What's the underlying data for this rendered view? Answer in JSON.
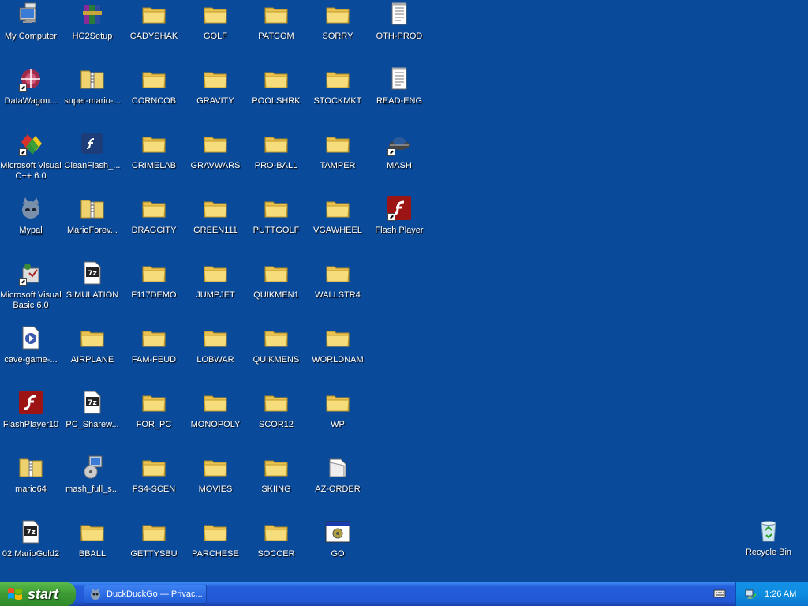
{
  "desktop": {
    "icons": [
      {
        "label": "My Computer",
        "type": "computer"
      },
      {
        "label": "DataWagon...",
        "type": "datawagon",
        "shortcut": true
      },
      {
        "label": "Microsoft Visual\nC++ 6.0",
        "type": "vcpp",
        "shortcut": true
      },
      {
        "label": "Mypal",
        "type": "mypal",
        "selected": true
      },
      {
        "label": "Microsoft Visual\nBasic 6.0",
        "type": "vb",
        "shortcut": true
      },
      {
        "label": "cave-game-...",
        "type": "media"
      },
      {
        "label": "FlashPlayer10",
        "type": "flash"
      },
      {
        "label": "mario64",
        "type": "zipfolder"
      },
      {
        "label": "02.MarioGold2",
        "type": "7z"
      },
      {
        "label": "HC2Setup",
        "type": "winrar"
      },
      {
        "label": "super-mario-...",
        "type": "zipfolder"
      },
      {
        "label": "CleanFlash_...",
        "type": "cleanflash"
      },
      {
        "label": "MarioForev...",
        "type": "zipfolder"
      },
      {
        "label": "SIMULATION",
        "type": "7z"
      },
      {
        "label": "AIRPLANE",
        "type": "folder"
      },
      {
        "label": "PC_Sharew...",
        "type": "7z"
      },
      {
        "label": "mash_full_s...",
        "type": "installer"
      },
      {
        "label": "BBALL",
        "type": "folder"
      },
      {
        "label": "CADYSHAK",
        "type": "folder"
      },
      {
        "label": "CORNCOB",
        "type": "folder"
      },
      {
        "label": "CRIMELAB",
        "type": "folder"
      },
      {
        "label": "DRAGCITY",
        "type": "folder"
      },
      {
        "label": "F117DEMO",
        "type": "folder"
      },
      {
        "label": "FAM-FEUD",
        "type": "folder"
      },
      {
        "label": "FOR_PC",
        "type": "folder"
      },
      {
        "label": "FS4-SCEN",
        "type": "folder"
      },
      {
        "label": "GETTYSBU",
        "type": "folder"
      },
      {
        "label": "GOLF",
        "type": "folder"
      },
      {
        "label": "GRAVITY",
        "type": "folder"
      },
      {
        "label": "GRAVWARS",
        "type": "folder"
      },
      {
        "label": "GREEN111",
        "type": "folder"
      },
      {
        "label": "JUMPJET",
        "type": "folder"
      },
      {
        "label": "LOBWAR",
        "type": "folder"
      },
      {
        "label": "MONOPOLY",
        "type": "folder"
      },
      {
        "label": "MOVIES",
        "type": "folder"
      },
      {
        "label": "PARCHESE",
        "type": "folder"
      },
      {
        "label": "PATCOM",
        "type": "folder"
      },
      {
        "label": "POOLSHRK",
        "type": "folder"
      },
      {
        "label": "PRO-BALL",
        "type": "folder"
      },
      {
        "label": "PUTTGOLF",
        "type": "folder"
      },
      {
        "label": "QUIKMEN1",
        "type": "folder"
      },
      {
        "label": "QUIKMENS",
        "type": "folder"
      },
      {
        "label": "SCOR12",
        "type": "folder"
      },
      {
        "label": "SKIING",
        "type": "folder"
      },
      {
        "label": "SOCCER",
        "type": "folder"
      },
      {
        "label": "SORRY",
        "type": "folder"
      },
      {
        "label": "STOCKMKT",
        "type": "folder"
      },
      {
        "label": "TAMPER",
        "type": "folder"
      },
      {
        "label": "VGAWHEEL",
        "type": "folder"
      },
      {
        "label": "WALLSTR4",
        "type": "folder"
      },
      {
        "label": "WORLDNAM",
        "type": "folder"
      },
      {
        "label": "WP",
        "type": "folder"
      },
      {
        "label": "AZ-ORDER",
        "type": "folderfile"
      },
      {
        "label": "GO",
        "type": "app"
      },
      {
        "label": "OTH-PROD",
        "type": "textfile"
      },
      {
        "label": "READ-ENG",
        "type": "textfile"
      },
      {
        "label": "MASH",
        "type": "mash",
        "shortcut": true
      },
      {
        "label": "Flash Player",
        "type": "flash",
        "shortcut": true
      }
    ],
    "recycle_bin": {
      "label": "Recycle Bin"
    }
  },
  "taskbar": {
    "start_label": "start",
    "window_button": "DuckDuckGo — Privac...",
    "clock": "1:26 AM"
  },
  "colors": {
    "desktop": "#0a4a9b",
    "folder": "#f3d56a",
    "flash": "#b01818"
  }
}
